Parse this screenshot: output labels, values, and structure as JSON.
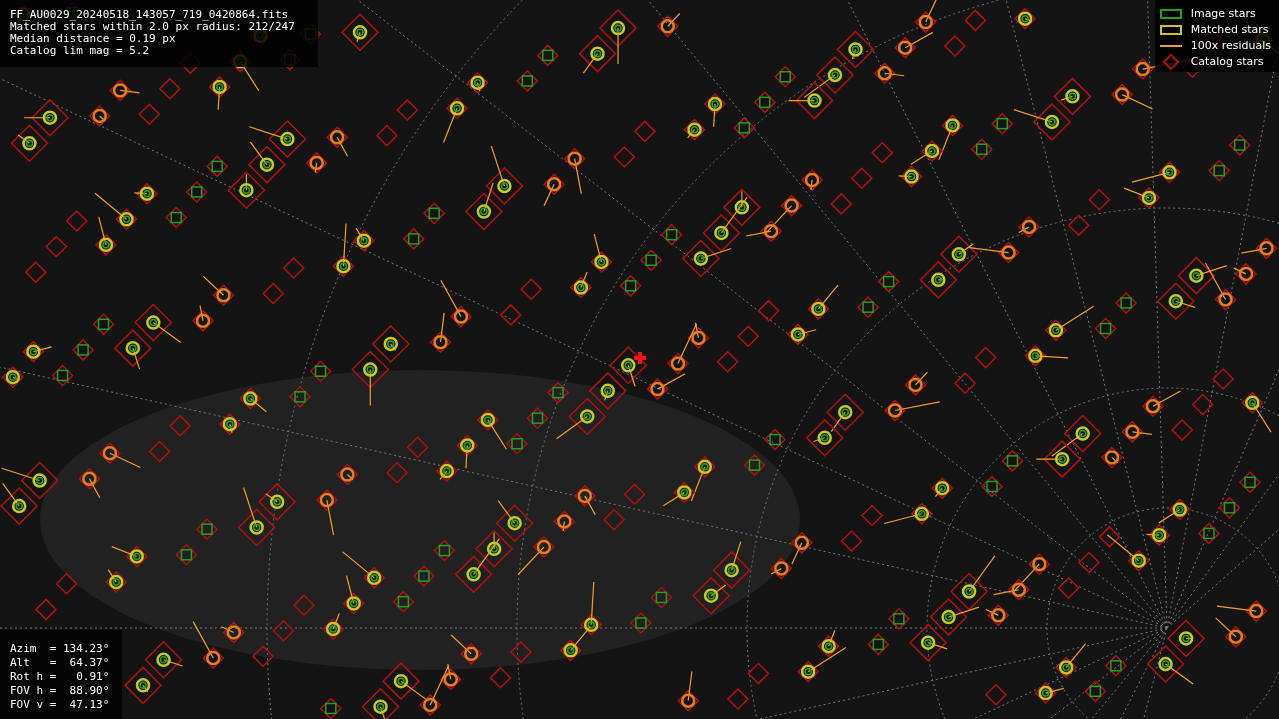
{
  "info": [
    "FF_AU0029_20240518_143057_719_0420864.fits",
    "Matched stars within 2.0 px radius: 212/247",
    "Median distance = 0.19 px",
    "Catalog lim mag = 5.2"
  ],
  "legend": [
    {
      "kind": "image",
      "label": "Image stars"
    },
    {
      "kind": "matched",
      "label": "Matched stars"
    },
    {
      "kind": "residual",
      "label": "100x residuals"
    },
    {
      "kind": "catalog",
      "label": "Catalog stars"
    }
  ],
  "pointing": [
    "Azim  = 134.23°",
    "Alt   =  64.37°",
    "Rot h =   0.91°",
    "FOV h =  88.90°",
    "FOV v =  47.13°"
  ]
}
